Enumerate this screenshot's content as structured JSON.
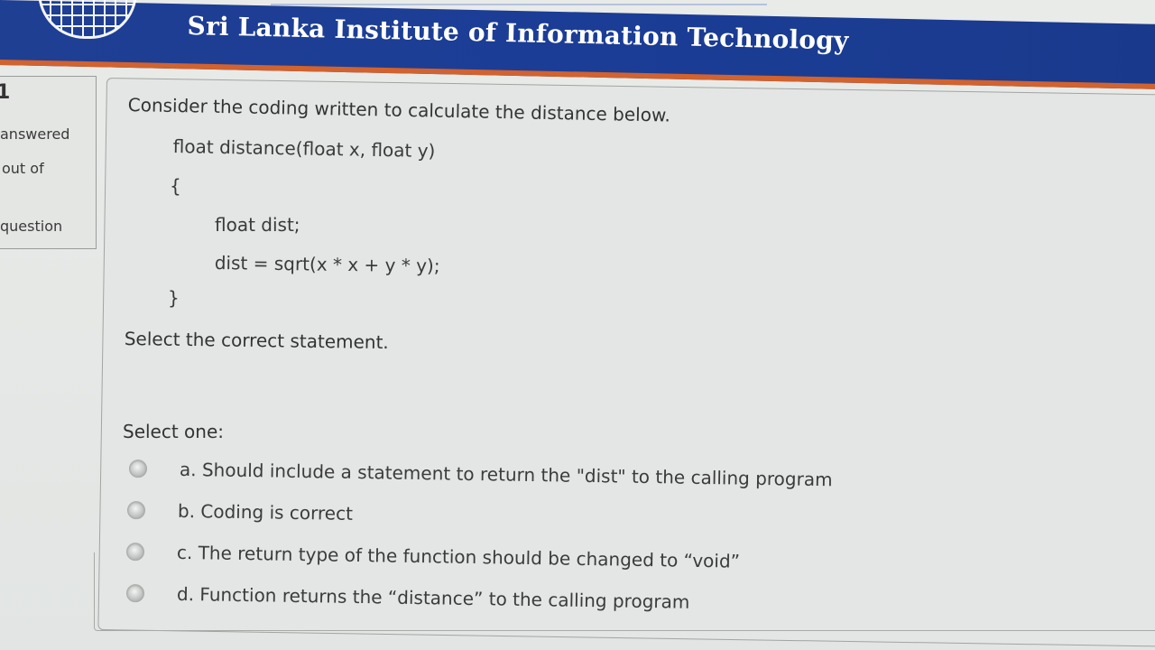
{
  "header": {
    "site_title": "Sri Lanka Institute of Information Technology"
  },
  "question_info": {
    "number": "1",
    "status": "answered",
    "marks": "out of",
    "flag": "question"
  },
  "question": {
    "intro": "Consider the coding written to calculate the distance below.",
    "code": [
      "float distance(float x, float y)",
      "{",
      "float dist;",
      "dist = sqrt(x * x + y * y);",
      "}"
    ],
    "prompt": "Select the correct statement.",
    "select_one": "Select one:",
    "options": [
      {
        "label": "a. Should include a statement to return the \"dist\" to the calling program"
      },
      {
        "label": "b. Coding is correct"
      },
      {
        "label": "c. The return type of the function should be changed to “void”"
      },
      {
        "label": "d. Function returns the “distance” to the calling program"
      }
    ]
  },
  "colors": {
    "header_blue": "#1f3f93",
    "header_stripe": "#d2622e",
    "text": "#333333"
  },
  "icons": {
    "logo": "globe-grid-logo-icon",
    "radio": "radio-unchecked-icon"
  }
}
